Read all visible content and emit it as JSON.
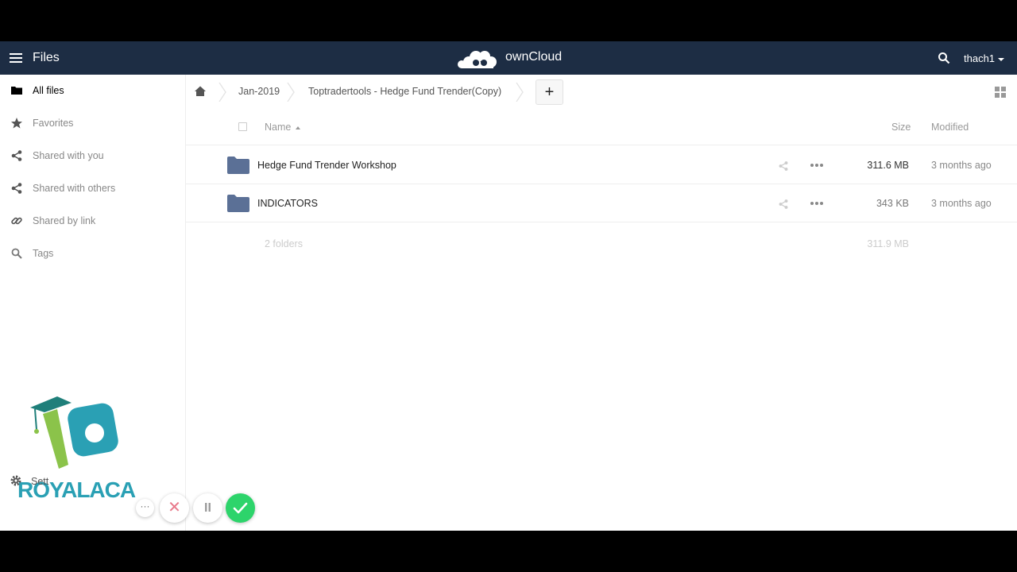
{
  "header": {
    "app_title": "Files",
    "brand": "ownCloud",
    "user": "thach1"
  },
  "sidebar": {
    "items": [
      {
        "label": "All files",
        "icon": "folder-icon"
      },
      {
        "label": "Favorites",
        "icon": "star-icon"
      },
      {
        "label": "Shared with you",
        "icon": "share-icon"
      },
      {
        "label": "Shared with others",
        "icon": "share-icon"
      },
      {
        "label": "Shared by link",
        "icon": "link-icon"
      },
      {
        "label": "Tags",
        "icon": "tag-search-icon"
      }
    ],
    "settings_label": "Sett"
  },
  "breadcrumb": {
    "items": [
      "Jan-2019",
      "Toptradertools - Hedge Fund Trender(Copy)"
    ],
    "new_label": "+"
  },
  "table": {
    "columns": {
      "name": "Name",
      "size": "Size",
      "modified": "Modified"
    },
    "rows": [
      {
        "name": "Hedge Fund Trender Workshop",
        "size": "311.6 MB",
        "modified": "3 months ago"
      },
      {
        "name": "INDICATORS",
        "size": "343 KB",
        "modified": "3 months ago"
      }
    ],
    "summary": {
      "count": "2 folders",
      "total": "311.9 MB"
    }
  },
  "overlay": {
    "brand_text": "ROYALACA",
    "more_label": "···",
    "cancel_label": "✕",
    "pause_label": "II"
  },
  "colors": {
    "header_bg": "#1d2d44",
    "folder": "#5b7096",
    "confirm": "#2dd46b"
  }
}
